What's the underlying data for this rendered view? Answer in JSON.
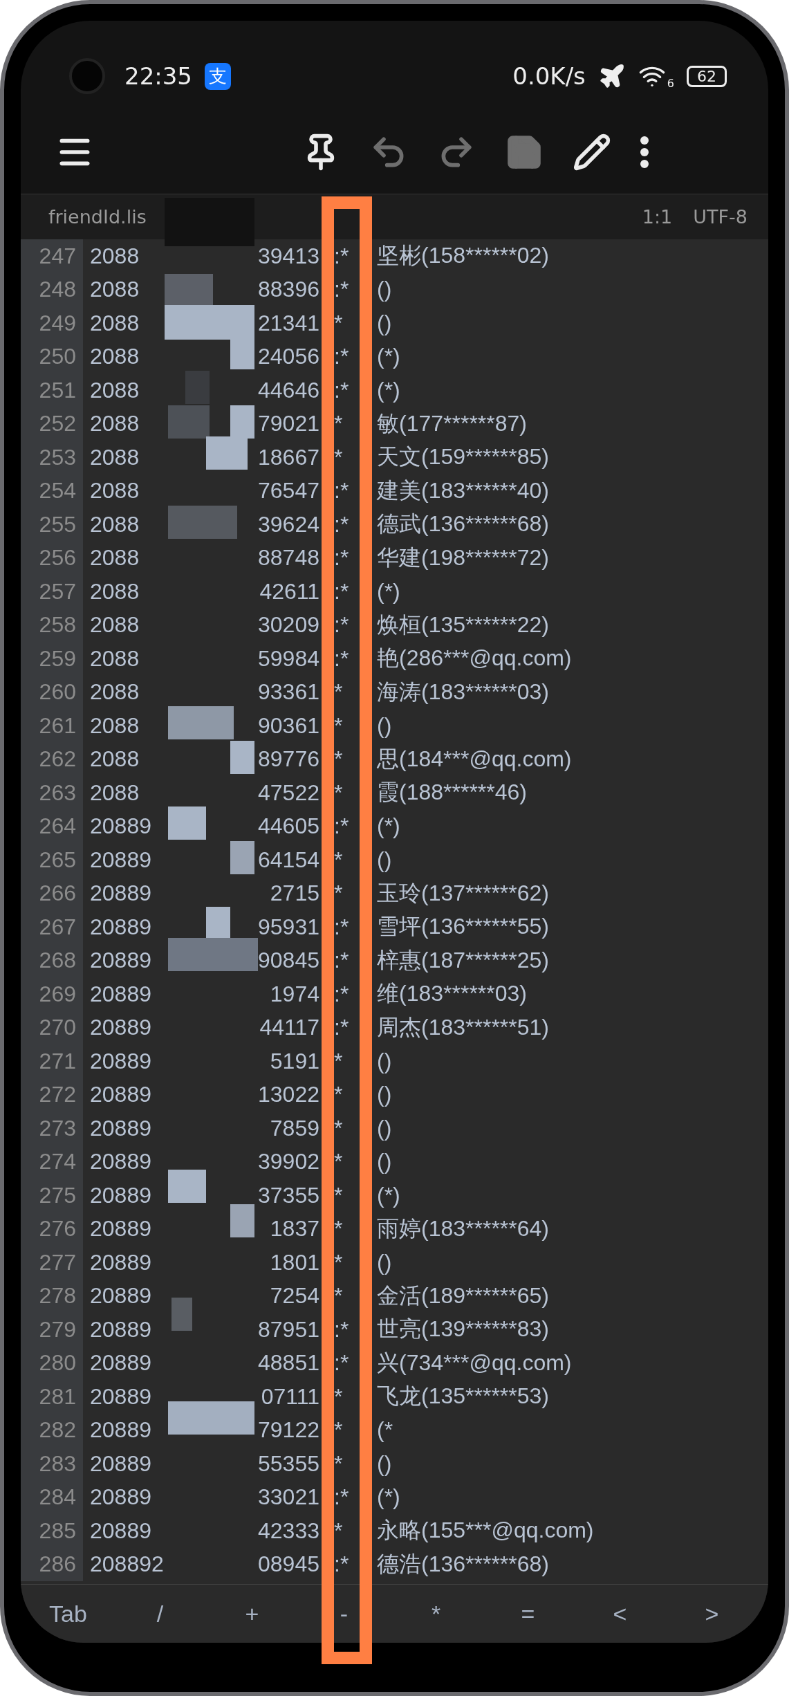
{
  "status_bar": {
    "time": "22:35",
    "app_badge": "支",
    "net_speed": "0.0K/s",
    "wifi_band": "6",
    "battery": "62"
  },
  "toolbar": [
    {
      "kind": "menu",
      "disabled": false
    },
    {
      "kind": "pin",
      "disabled": false
    },
    {
      "kind": "undo",
      "disabled": true
    },
    {
      "kind": "redo",
      "disabled": true
    },
    {
      "kind": "save",
      "disabled": true
    },
    {
      "kind": "edit",
      "disabled": false
    },
    {
      "kind": "more",
      "disabled": false
    }
  ],
  "file_tab": {
    "name": "friendId.lis",
    "position": "1:1",
    "encoding": "UTF-8"
  },
  "lines": [
    {
      "number": "247",
      "prefix": "2088",
      "tail": "39413",
      "mid": ":*",
      "rest": "坚彬(158******02)"
    },
    {
      "number": "248",
      "prefix": "2088",
      "tail": "88396",
      "mid": ":*",
      "rest": "()"
    },
    {
      "number": "249",
      "prefix": "2088",
      "tail": "21341",
      "mid": "*",
      "rest": "()"
    },
    {
      "number": "250",
      "prefix": "2088",
      "tail": "24056",
      "mid": ":*",
      "rest": "(*)"
    },
    {
      "number": "251",
      "prefix": "2088",
      "tail": "44646",
      "mid": ":*",
      "rest": "(*)"
    },
    {
      "number": "252",
      "prefix": "2088",
      "tail": "79021",
      "mid": "*",
      "rest": "敏(177******87)"
    },
    {
      "number": "253",
      "prefix": "2088",
      "tail": "18667",
      "mid": "*",
      "rest": "天文(159******85)"
    },
    {
      "number": "254",
      "prefix": "2088",
      "tail": "76547",
      "mid": ":*",
      "rest": "建美(183******40)"
    },
    {
      "number": "255",
      "prefix": "2088",
      "tail": "39624",
      "mid": ":*",
      "rest": "德武(136******68)"
    },
    {
      "number": "256",
      "prefix": "2088",
      "tail": "88748",
      "mid": ":*",
      "rest": "华建(198******72)"
    },
    {
      "number": "257",
      "prefix": "2088",
      "tail": "42611",
      "mid": ":*",
      "rest": "(*)"
    },
    {
      "number": "258",
      "prefix": "2088",
      "tail": "30209",
      "mid": ":*",
      "rest": "焕桓(135******22)"
    },
    {
      "number": "259",
      "prefix": "2088",
      "tail": "59984",
      "mid": ":*",
      "rest": "艳(286***@qq.com)"
    },
    {
      "number": "260",
      "prefix": "2088",
      "tail": "93361",
      "mid": "*",
      "rest": "海涛(183******03)"
    },
    {
      "number": "261",
      "prefix": "2088",
      "tail": "90361",
      "mid": "*",
      "rest": "()"
    },
    {
      "number": "262",
      "prefix": "2088",
      "tail": "89776",
      "mid": "*",
      "rest": "思(184***@qq.com)"
    },
    {
      "number": "263",
      "prefix": "2088",
      "tail": "47522",
      "mid": "*",
      "rest": "霞(188******46)"
    },
    {
      "number": "264",
      "prefix": "20889",
      "tail": "44605",
      "mid": ":*",
      "rest": "(*)"
    },
    {
      "number": "265",
      "prefix": "20889",
      "tail": "64154",
      "mid": "*",
      "rest": "()"
    },
    {
      "number": "266",
      "prefix": "20889",
      "tail": "2715",
      "mid": "*",
      "rest": "玉玲(137******62)"
    },
    {
      "number": "267",
      "prefix": "20889",
      "tail": "95931",
      "mid": ":*",
      "rest": "雪坪(136******55)"
    },
    {
      "number": "268",
      "prefix": "20889",
      "tail": "90845",
      "mid": ":*",
      "rest": "梓惠(187******25)"
    },
    {
      "number": "269",
      "prefix": "20889",
      "tail": "1974",
      "mid": ":*",
      "rest": "维(183******03)"
    },
    {
      "number": "270",
      "prefix": "20889",
      "tail": "44117",
      "mid": ":*",
      "rest": "周杰(183******51)"
    },
    {
      "number": "271",
      "prefix": "20889",
      "tail": "5191",
      "mid": "*",
      "rest": "()"
    },
    {
      "number": "272",
      "prefix": "20889",
      "tail": "13022",
      "mid": "*",
      "rest": "()"
    },
    {
      "number": "273",
      "prefix": "20889",
      "tail": "7859",
      "mid": "*",
      "rest": "()"
    },
    {
      "number": "274",
      "prefix": "20889",
      "tail": "39902",
      "mid": "*",
      "rest": "()"
    },
    {
      "number": "275",
      "prefix": "20889",
      "tail": "37355",
      "mid": "*",
      "rest": "(*)"
    },
    {
      "number": "276",
      "prefix": "20889",
      "tail": "1837",
      "mid": "*",
      "rest": "雨婷(183******64)"
    },
    {
      "number": "277",
      "prefix": "20889",
      "tail": "1801",
      "mid": "*",
      "rest": "()"
    },
    {
      "number": "278",
      "prefix": "20889",
      "tail": "7254",
      "mid": "*",
      "rest": "金活(189******65)"
    },
    {
      "number": "279",
      "prefix": "20889",
      "tail": "87951",
      "mid": ":*",
      "rest": "世亮(139******83)"
    },
    {
      "number": "280",
      "prefix": "20889",
      "tail": "48851",
      "mid": ":*",
      "rest": "兴(734***@qq.com)"
    },
    {
      "number": "281",
      "prefix": "20889",
      "tail": "07111",
      "mid": "*",
      "rest": "飞龙(135******53)"
    },
    {
      "number": "282",
      "prefix": "20889",
      "tail": "79122",
      "mid": "*",
      "rest": "(*"
    },
    {
      "number": "283",
      "prefix": "20889",
      "tail": "55355",
      "mid": "*",
      "rest": "()"
    },
    {
      "number": "284",
      "prefix": "20889",
      "tail": "33021",
      "mid": ":*",
      "rest": "(*)"
    },
    {
      "number": "285",
      "prefix": "20889",
      "tail": "42333",
      "mid": "*",
      "rest": "永略(155***@qq.com)"
    },
    {
      "number": "286",
      "prefix": "208892",
      "tail": "08945",
      "mid": ":*",
      "rest": "德浩(136******68)"
    }
  ],
  "keys": [
    "Tab",
    "/",
    "+",
    "-",
    "*",
    "=",
    "<",
    ">"
  ]
}
